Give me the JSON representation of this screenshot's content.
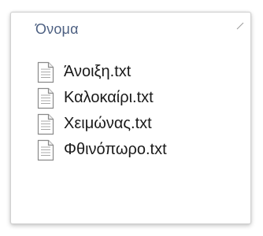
{
  "column_header": {
    "label": "Όνομα"
  },
  "files": [
    {
      "name": "Άνοιξη.txt",
      "icon": "text-file-icon"
    },
    {
      "name": "Καλοκαίρι.txt",
      "icon": "text-file-icon"
    },
    {
      "name": "Χειμώνας.txt",
      "icon": "text-file-icon"
    },
    {
      "name": "Φθινόπωρο.txt",
      "icon": "text-file-icon"
    }
  ],
  "colors": {
    "header_text": "#4d6082",
    "item_text": "#1a1a1a",
    "panel_border": "#d2d2d2",
    "icon_outline": "#8a8a8a"
  }
}
